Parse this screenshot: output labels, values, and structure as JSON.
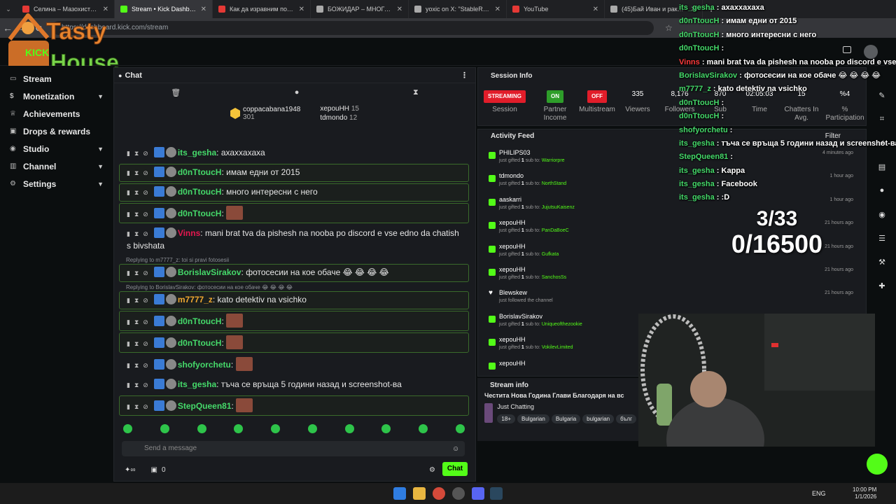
{
  "browser": {
    "tabs": [
      {
        "title": "Селина – Мазохистка | Selin",
        "color": "#e53935"
      },
      {
        "title": "Stream • Kick Dashboard",
        "color": "#53fc18",
        "active": true
      },
      {
        "title": "Как да изравним подовете",
        "color": "#e53935"
      },
      {
        "title": "БОЖИДАР – МНОГО СМЕШ",
        "color": "#aaaaaa"
      },
      {
        "title": "yoxic on X: \"StableRonaldo",
        "color": "#aaaaaa"
      },
      {
        "title": "YouTube",
        "color": "#e53935"
      },
      {
        "title": "(45)Бай Иван и ракията",
        "color": "#aaaaaa"
      }
    ],
    "url": "https://dashboard.kick.com/stream"
  },
  "logo": {
    "line1": "Tasty",
    "line2": "House",
    "small": "KICK"
  },
  "sidebar": {
    "items": [
      {
        "label": "Stream",
        "icon": "tv-icon",
        "chev": false
      },
      {
        "label": "Monetization",
        "icon": "money-icon",
        "chev": true
      },
      {
        "label": "Achievements",
        "icon": "trophy-icon",
        "chev": false
      },
      {
        "label": "Drops & rewards",
        "icon": "gift-icon",
        "chev": false
      },
      {
        "label": "Studio",
        "icon": "studio-icon",
        "chev": true
      },
      {
        "label": "Channel",
        "icon": "channel-icon",
        "chev": true
      },
      {
        "label": "Settings",
        "icon": "gear-icon",
        "chev": true
      }
    ]
  },
  "chat": {
    "title": "Chat",
    "gifters": [
      {
        "name": "coppacabana1948",
        "count": "301"
      },
      {
        "name": "xepouHH",
        "count": "15"
      },
      {
        "name": "tdmondo",
        "count": "12"
      }
    ],
    "messages": [
      {
        "user": "its_gesha",
        "color": "#45d96a",
        "text": "ахаххахаха",
        "hl": false,
        "emote": false
      },
      {
        "user": "d0nTtoucH",
        "color": "#45d96a",
        "text": "имам едни от 2015",
        "hl": true,
        "emote": false
      },
      {
        "user": "d0nTtoucH",
        "color": "#45d96a",
        "text": "много интересни с него",
        "hl": true,
        "emote": false
      },
      {
        "user": "d0nTtoucH",
        "color": "#45d96a",
        "text": "",
        "hl": true,
        "emote": true
      },
      {
        "user": "Vinns",
        "color": "#e5174f",
        "text": "mani brat tva da pishesh na nooba po discord e vse edno da chatish s bivshata",
        "hl": false,
        "emote": false
      },
      {
        "reply": "Replying to m7777_z: toi si pravi fotosesii"
      },
      {
        "user": "BorislavSirakov",
        "color": "#45d96a",
        "text": "фотосесии на кое обаче 😂 😂 😂 😂",
        "hl": true,
        "emote": false
      },
      {
        "reply": "Replying to BorislavSirakov: фотосесии на кое обаче 😂 😂 😂 😂"
      },
      {
        "user": "m7777_z",
        "color": "#f0a830",
        "text": "kato detektiv na vsichko",
        "hl": true,
        "emote": false
      },
      {
        "user": "d0nTtoucH",
        "color": "#45d96a",
        "text": "",
        "hl": true,
        "emote": true
      },
      {
        "user": "d0nTtoucH",
        "color": "#45d96a",
        "text": "",
        "hl": true,
        "emote": true
      },
      {
        "user": "shofyorchetu",
        "color": "#45d96a",
        "text": "",
        "hl": false,
        "emote": true
      },
      {
        "user": "its_gesha",
        "color": "#45d96a",
        "text": "тъча се връща 5 години назад и screenshot-ва",
        "hl": false,
        "emote": false
      },
      {
        "user": "StepQueen81",
        "color": "#45d96a",
        "text": "",
        "hl": true,
        "emote": true
      },
      {
        "user": "its_gesha",
        "color": "#45d96a",
        "text": "Kappa",
        "hl": false,
        "emote": false
      },
      {
        "user": "its_gesha",
        "color": "#45d96a",
        "text": "Facebook",
        "hl": false,
        "emote": false
      },
      {
        "user": "its_gesha",
        "color": "#45d96a",
        "text": ":D",
        "hl": false,
        "emote": false
      }
    ],
    "input_placeholder": "Send a message",
    "footer_count": "0",
    "send_label": "Chat"
  },
  "session": {
    "title": "Session Info",
    "stats": [
      {
        "pill": "STREAMING",
        "pillColor": "#e11d2a",
        "label": "Session"
      },
      {
        "pill": "ON",
        "pillColor": "#2e9e2a",
        "label": "Partner Income"
      },
      {
        "pill": "OFF",
        "pillColor": "#e11d2a",
        "label": "Multistream"
      },
      {
        "value": "335",
        "label": "Viewers"
      },
      {
        "value": "8,176",
        "label": "Followers"
      },
      {
        "value": "870",
        "label": "Sub"
      },
      {
        "value": "02:05:03",
        "label": "Time"
      },
      {
        "value": "15",
        "label": "Chatters In Avg."
      },
      {
        "value": "%4",
        "label": "% Participation"
      }
    ]
  },
  "activity": {
    "title": "Activity Feed",
    "filter": "Filter",
    "items": [
      {
        "name": "PHILIPS03",
        "pre": "just gifted",
        "n": "1",
        "mid": "sub to:",
        "rec": "Warriorpre",
        "time": "4 minutes ago",
        "heart": false
      },
      {
        "name": "tdmondo",
        "pre": "just gifted",
        "n": "1",
        "mid": "sub to:",
        "rec": "NorthStand",
        "time": "1 hour ago",
        "heart": false
      },
      {
        "name": "aaskarri",
        "pre": "just gifted",
        "n": "1",
        "mid": "sub to:",
        "rec": "JujutsuKaisenz",
        "time": "1 hour ago",
        "heart": false
      },
      {
        "name": "xepouHH",
        "pre": "just gifted",
        "n": "1",
        "mid": "sub to:",
        "rec": "PanDaBoeC",
        "time": "21 hours ago",
        "heart": false
      },
      {
        "name": "xepouHH",
        "pre": "just gifted",
        "n": "1",
        "mid": "sub to:",
        "rec": "Gufkata",
        "time": "21 hours ago",
        "heart": false
      },
      {
        "name": "xepouHH",
        "pre": "just gifted",
        "n": "1",
        "mid": "sub to:",
        "rec": "SanchosSs",
        "time": "21 hours ago",
        "heart": false
      },
      {
        "name": "Blewskew",
        "pre": "just followed the channel",
        "n": "",
        "mid": "",
        "rec": "",
        "time": "21 hours ago",
        "heart": true
      },
      {
        "name": "BorislavSirakov",
        "pre": "just gifted",
        "n": "1",
        "mid": "sub to:",
        "rec": "Uniqueofthezookie",
        "time": "",
        "heart": false
      },
      {
        "name": "xepouHH",
        "pre": "just gifted",
        "n": "1",
        "mid": "sub to:",
        "rec": "VokilevLimited",
        "time": "",
        "heart": false
      },
      {
        "name": "xepouHH",
        "pre": "",
        "n": "",
        "mid": "",
        "rec": "",
        "time": "",
        "heart": false
      }
    ]
  },
  "stream_info": {
    "title": "Stream info",
    "stream_title": "Честита Нова Година Глави  Благодаря на вс",
    "category": "Just Chatting",
    "tags": [
      "18+",
      "Bulgarian",
      "Bulgaria",
      "bulgarian",
      "бълг"
    ]
  },
  "overlay": {
    "lines": [
      {
        "user": "its_gesha",
        "text": "ахаххахаха",
        "red": false
      },
      {
        "user": "d0nTtoucH",
        "text": "имам едни от 2015",
        "red": false
      },
      {
        "user": "d0nTtoucH",
        "text": "много интересни с него",
        "red": false
      },
      {
        "user": "d0nTtoucH",
        "text": "",
        "red": false
      },
      {
        "user": "Vinns",
        "text": "mani brat tva da pishesh na nooba po discord e vse edno da chatish s bivshata",
        "red": true
      },
      {
        "user": "BorislavSirakov",
        "text": "фотосесии на кое обаче 😂 😂 😂 😂",
        "red": false
      },
      {
        "user": "m7777_z",
        "text": "kato detektiv na vsichko",
        "red": false
      },
      {
        "user": "d0nTtoucH",
        "text": "",
        "red": false
      },
      {
        "user": "d0nTtoucH",
        "text": "",
        "red": false
      },
      {
        "user": "shofyorchetu",
        "text": "",
        "red": false
      },
      {
        "user": "its_gesha",
        "text": "тъча се връща 5 години назад и screenshot-ва",
        "red": false
      },
      {
        "user": "StepQueen81",
        "text": "",
        "red": false
      },
      {
        "user": "its_gesha",
        "text": "Kappa",
        "red": false
      },
      {
        "user": "its_gesha",
        "text": "Facebook",
        "red": false
      },
      {
        "user": "its_gesha",
        "text": ":D",
        "red": false
      }
    ],
    "counter_subs": "3/33",
    "counter_goal": "0/16500"
  },
  "taskbar": {
    "lang": "ENG",
    "time": "10:00 PM",
    "date": "1/1/2026"
  }
}
